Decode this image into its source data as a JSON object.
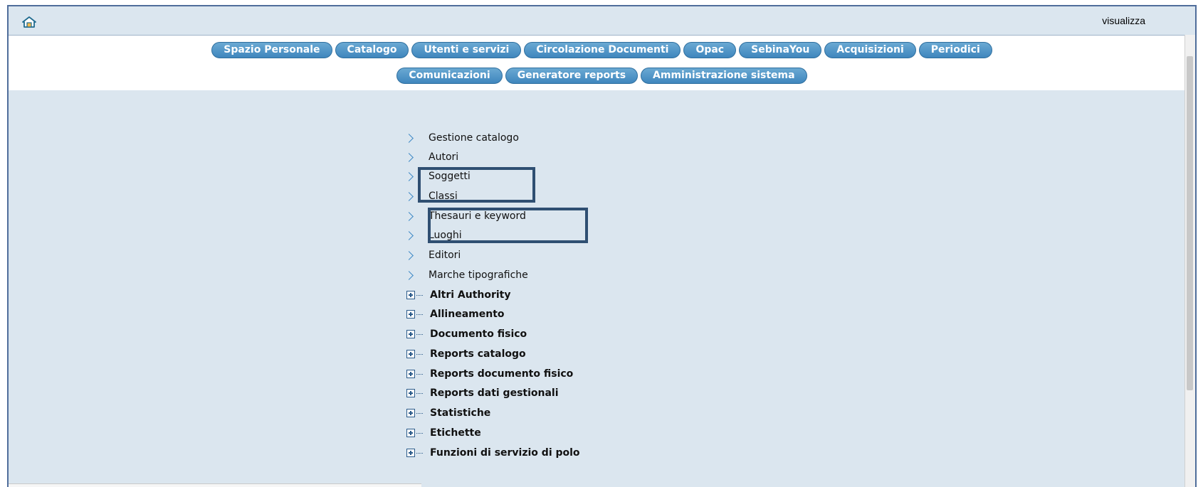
{
  "topbar": {
    "home_icon": "home-icon",
    "visualizza": "visualizza"
  },
  "nav": {
    "row1": [
      "Spazio Personale",
      "Catalogo",
      "Utenti e servizi",
      "Circolazione Documenti",
      "Opac",
      "SebinaYou",
      "Acquisizioni",
      "Periodici"
    ],
    "row2": [
      "Comunicazioni",
      "Generatore reports",
      "Amministrazione sistema"
    ]
  },
  "menu": {
    "leaves": [
      "Gestione catalogo",
      "Autori",
      "Soggetti",
      "Classi",
      "Thesauri e keyword",
      "Luoghi",
      "Editori",
      "Marche tipografiche"
    ],
    "groups": [
      "Altri Authority",
      "Allineamento",
      "Documento fisico",
      "Reports catalogo",
      "Reports documento fisico",
      "Reports dati gestionali",
      "Statistiche",
      "Etichette",
      "Funzioni di servizio di polo"
    ]
  },
  "colors": {
    "accent": "#3f86bd",
    "highlight": "#2f4f72",
    "panel": "#dbe6ef"
  }
}
